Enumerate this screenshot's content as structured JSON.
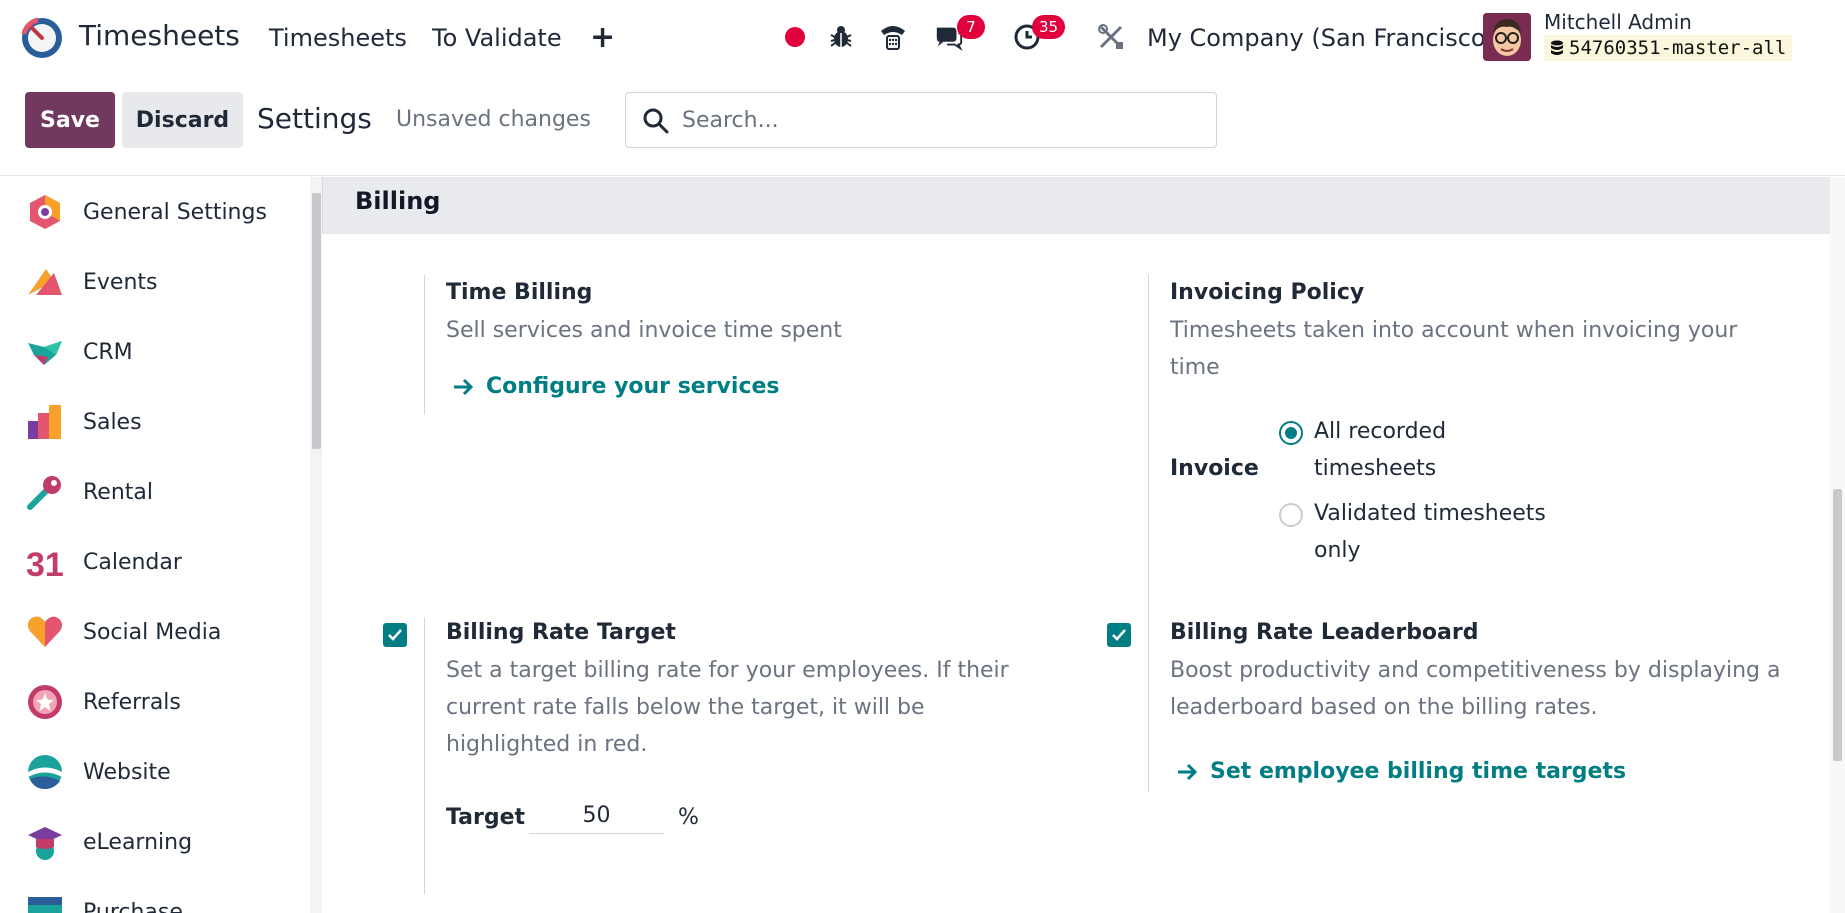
{
  "navbar": {
    "app_title": "Timesheets",
    "menu": [
      "Timesheets",
      "To Validate"
    ],
    "plus_label": "+",
    "messages_count": "7",
    "activities_count": "35",
    "company": "My Company (San Francisco)",
    "user_name": "Mitchell Admin",
    "database": "54760351-master-all"
  },
  "control": {
    "save_label": "Save",
    "discard_label": "Discard",
    "title": "Settings",
    "status": "Unsaved changes",
    "search_placeholder": "Search..."
  },
  "sidebar": {
    "items": [
      {
        "label": "General Settings",
        "icon": "general-settings-icon"
      },
      {
        "label": "Events",
        "icon": "events-icon"
      },
      {
        "label": "CRM",
        "icon": "crm-icon"
      },
      {
        "label": "Sales",
        "icon": "sales-icon"
      },
      {
        "label": "Rental",
        "icon": "rental-icon"
      },
      {
        "label": "Calendar",
        "icon": "calendar-icon"
      },
      {
        "label": "Social Media",
        "icon": "social-media-icon"
      },
      {
        "label": "Referrals",
        "icon": "referrals-icon"
      },
      {
        "label": "Website",
        "icon": "website-icon"
      },
      {
        "label": "eLearning",
        "icon": "elearning-icon"
      },
      {
        "label": "Purchase",
        "icon": "purchase-icon"
      }
    ],
    "calendar_icon_text": "31"
  },
  "billing": {
    "section_title": "Billing",
    "time_billing": {
      "title": "Time Billing",
      "description": "Sell services and invoice time spent",
      "link": "Configure your services"
    },
    "invoicing_policy": {
      "title": "Invoicing Policy",
      "description": "Timesheets taken into account when invoicing your time",
      "field_label": "Invoice",
      "options": [
        {
          "label": "All recorded timesheets",
          "selected": true
        },
        {
          "label": "Validated timesheets only",
          "selected": false
        }
      ]
    },
    "billing_rate_target": {
      "checked": true,
      "title": "Billing Rate Target",
      "description": "Set a target billing rate for your employees. If their current rate falls below the target, it will be highlighted in red.",
      "target_label": "Target",
      "target_value": "50",
      "unit": "%"
    },
    "billing_rate_leaderboard": {
      "checked": true,
      "title": "Billing Rate Leaderboard",
      "description": "Boost productivity and competitiveness by displaying a leaderboard based on the billing rates.",
      "link": "Set employee billing time targets"
    }
  },
  "colors": {
    "brand": "#71395f",
    "accent": "#017e84",
    "badge": "#e0003c"
  }
}
